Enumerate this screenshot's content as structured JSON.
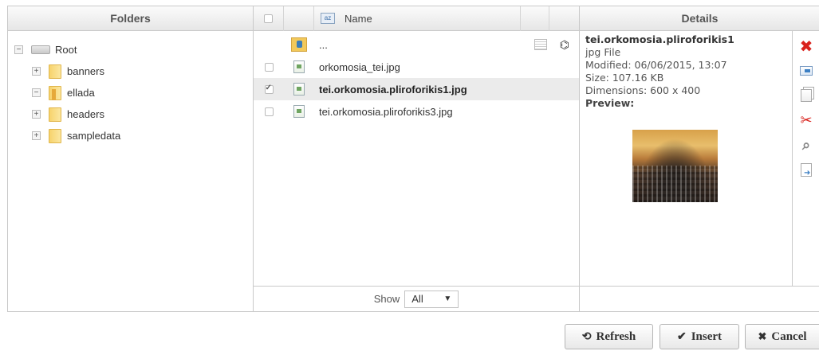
{
  "folders": {
    "header": "Folders",
    "root_label": "Root",
    "items": [
      {
        "label": "banners",
        "expander": "+"
      },
      {
        "label": "ellada",
        "expander": "−"
      },
      {
        "label": "headers",
        "expander": "+"
      },
      {
        "label": "sampledata",
        "expander": "+"
      }
    ],
    "root_expander": "−"
  },
  "files": {
    "name_header": "Name",
    "up_label": "...",
    "rows": [
      {
        "name": "orkomosia_tei.jpg",
        "checked": false,
        "selected": false
      },
      {
        "name": "tei.orkomosia.pliroforikis1.jpg",
        "checked": true,
        "selected": true
      },
      {
        "name": "tei.orkomosia.pliroforikis3.jpg",
        "checked": false,
        "selected": false
      }
    ],
    "show_label": "Show",
    "show_value": "All"
  },
  "details": {
    "header": "Details",
    "title": "tei.orkomosia.pliroforikis1",
    "type": "jpg File",
    "modified": "Modified: 06/06/2015, 13:07",
    "size": "Size: 107.16 KB",
    "dimensions": "Dimensions: 600 x 400",
    "preview_label": "Preview:"
  },
  "buttons": {
    "refresh": "Refresh",
    "insert": "Insert",
    "cancel": "Cancel"
  },
  "icons": {
    "delete": "close-icon",
    "rename": "rename-icon",
    "copy": "copy-icon",
    "cut": "cut-icon",
    "zoom": "magnifier-icon",
    "download": "download-icon"
  },
  "colors": {
    "delete": "#d9221c",
    "accent": "#3c7fc4"
  }
}
